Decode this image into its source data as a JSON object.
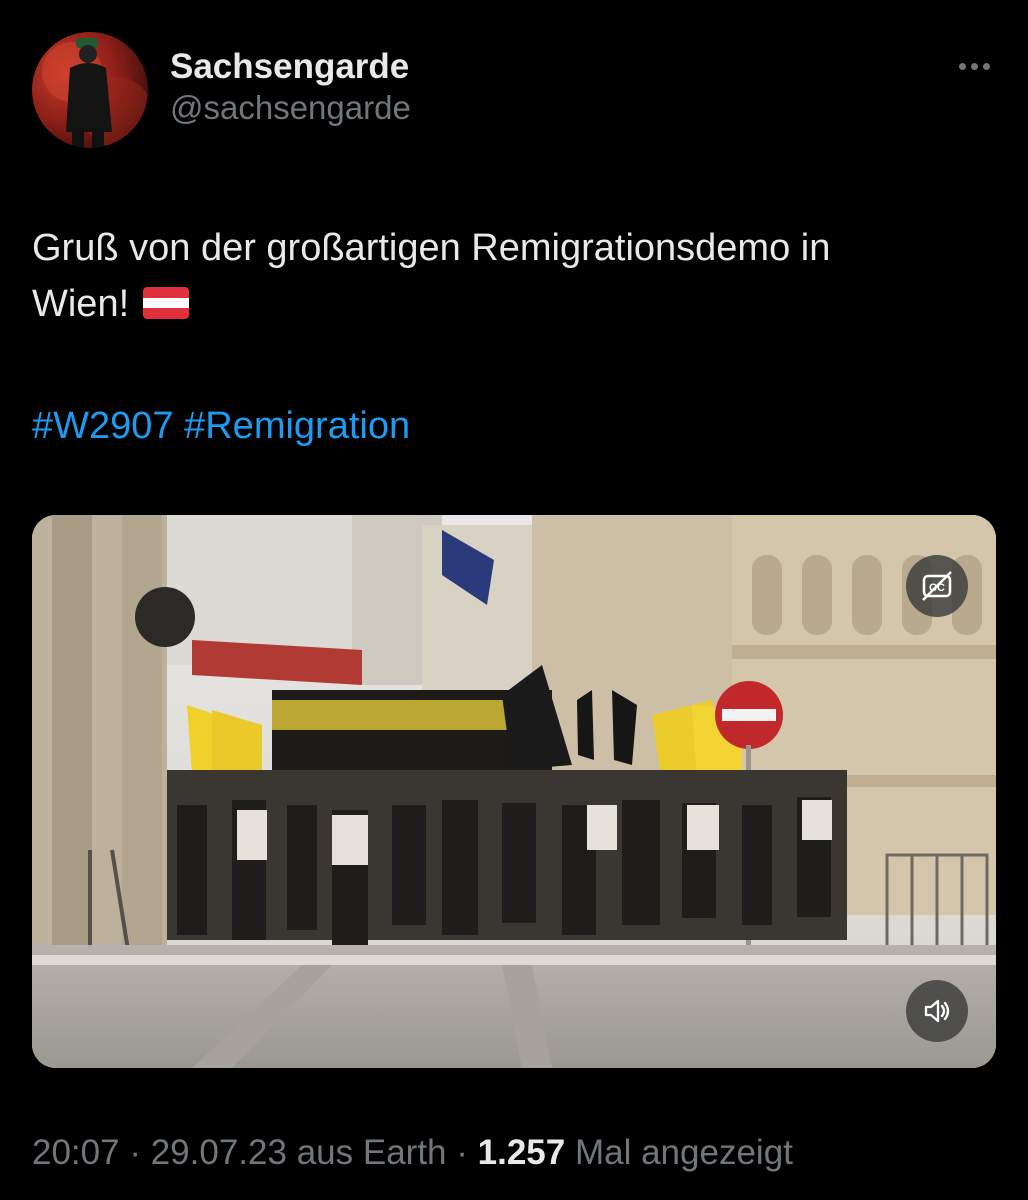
{
  "author": {
    "display_name": "Sachsengarde",
    "handle": "@sachsengarde"
  },
  "tweet": {
    "text_line1": "Gruß von der großartigen Remigrationsdemo in",
    "text_line2": "Wien!",
    "flag": {
      "name": "austria-flag-icon",
      "colors": [
        "#e0303b",
        "#ffffff",
        "#e0303b"
      ]
    },
    "hashtags": [
      "#W2907",
      "#Remigration"
    ]
  },
  "media": {
    "type": "video",
    "captions_icon": "captions-off-icon",
    "mute_icon": "speaker-muted-icon"
  },
  "meta": {
    "time": "20:07",
    "separator": "·",
    "date": "29.07.23",
    "source": "aus Earth",
    "views_count": "1.257",
    "views_label": "Mal angezeigt"
  },
  "colors": {
    "background": "#000000",
    "text_primary": "#e7e9ea",
    "text_secondary": "#71767b",
    "accent": "#1d9bf0"
  }
}
